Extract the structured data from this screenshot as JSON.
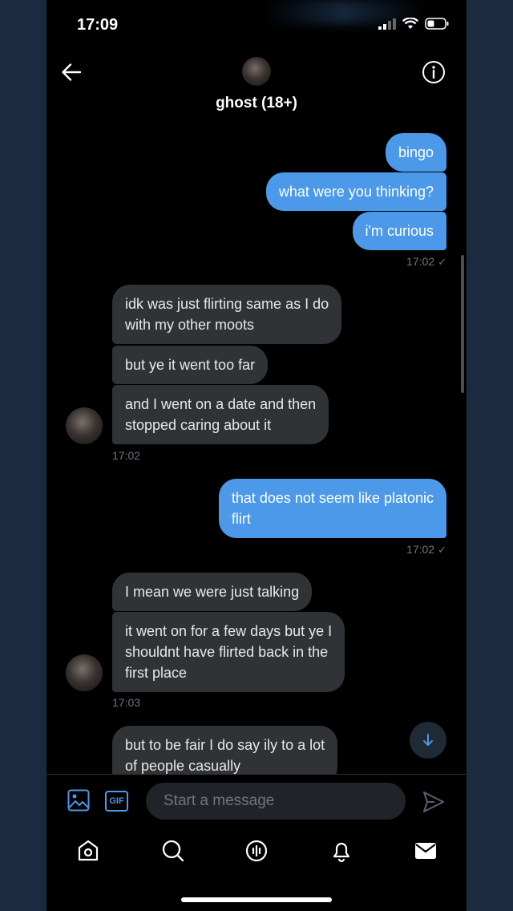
{
  "status": {
    "time": "17:09"
  },
  "header": {
    "name": "ghost (18+)"
  },
  "messages": {
    "m1": "bingo",
    "m2": "what were you thinking?",
    "m3": "i'm curious",
    "ts1": "17:02",
    "m4": "idk was just flirting same as I do\nwith my other moots",
    "m5": "but ye it went too far",
    "m6": "and I went on a date and then\nstopped caring about it",
    "ts2": "17:02",
    "m7": "that does not seem like platonic\nflirt",
    "ts3": "17:02",
    "m8": "I mean we were just talking",
    "m9": "it went on for a few days but ye I\nshouldnt have flirted back in the\nfirst place",
    "ts4": "17:03",
    "m10": "but to be fair I do say ily to a lot\nof people casually"
  },
  "composer": {
    "placeholder": "Start a message",
    "gif_label": "GIF"
  },
  "colors": {
    "accent": "#4c99e9",
    "received_bubble": "#2f3336"
  },
  "icons": [
    "back-arrow-icon",
    "info-icon",
    "media-icon",
    "gif-icon",
    "send-icon",
    "home-icon",
    "search-icon",
    "spaces-icon",
    "notifications-icon",
    "messages-icon",
    "scroll-down-icon"
  ]
}
